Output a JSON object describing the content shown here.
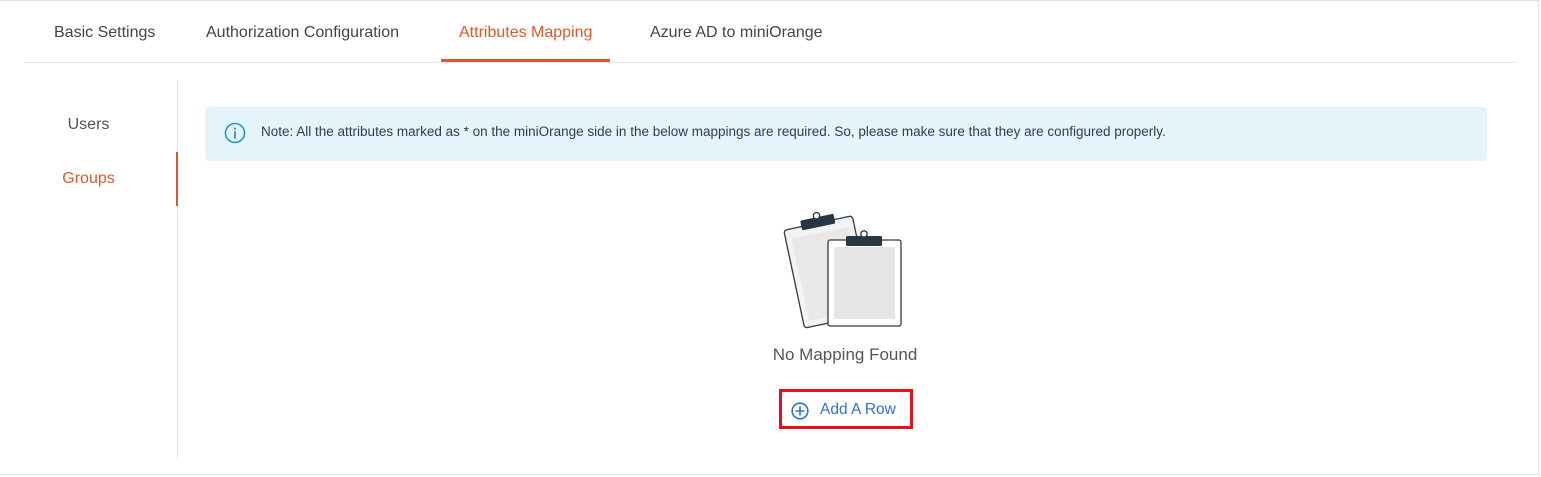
{
  "tabs": [
    {
      "label": "Basic Settings"
    },
    {
      "label": "Authorization Configuration"
    },
    {
      "label": "Attributes Mapping"
    },
    {
      "label": "Azure AD to miniOrange"
    }
  ],
  "active_tab": "Attributes Mapping",
  "sidebar": {
    "items": [
      {
        "label": "Users"
      },
      {
        "label": "Groups"
      }
    ],
    "active": "Groups"
  },
  "note": {
    "icon": "info-icon",
    "text": "Note: All the attributes marked as * on the miniOrange side in the below mappings are required. So, please make sure that they are configured properly."
  },
  "empty_state": {
    "illustration": "clipboards-icon",
    "message": "No Mapping Found"
  },
  "add_row": {
    "icon": "plus-circle-icon",
    "label": "Add A Row"
  },
  "colors": {
    "accent": "#e2562b",
    "link": "#2b72d6",
    "note_bg": "#e5f4fb",
    "highlight": "#e8101a"
  }
}
